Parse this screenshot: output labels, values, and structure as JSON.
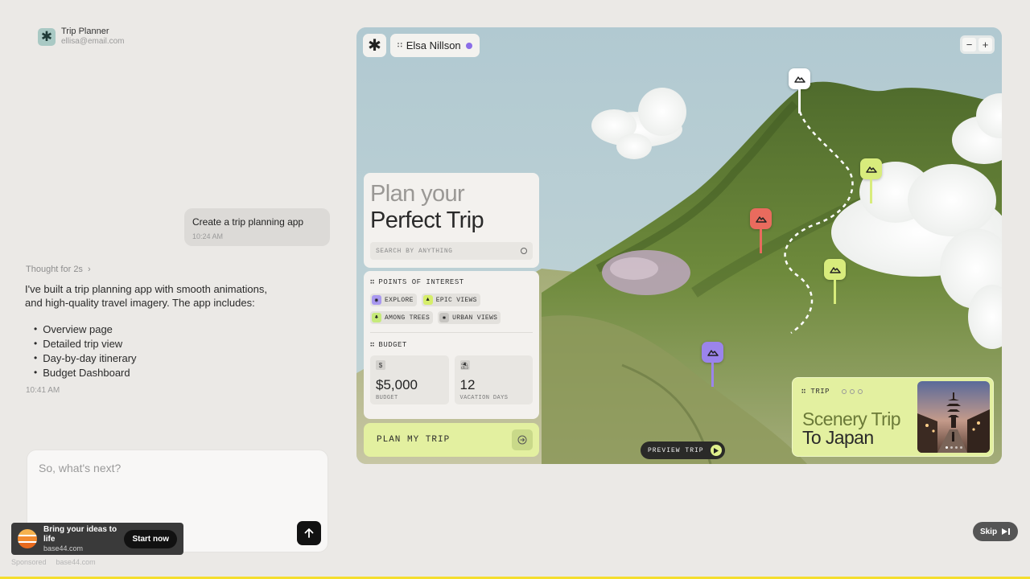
{
  "app": {
    "title": "Trip Planner",
    "email": "ellisa@email.com"
  },
  "chat": {
    "user_message": {
      "text": "Create a trip planning app",
      "time": "10:24 AM"
    },
    "thought": "Thought for 2s",
    "assistant_intro": "I've built a trip planning app with smooth animations, and high-quality travel imagery. The app includes:",
    "features": [
      "Overview page",
      "Detailed trip view",
      "Day-by-day itinerary",
      "Budget Dashboard"
    ],
    "assistant_time": "10:41 AM"
  },
  "composer": {
    "placeholder": "So, what's next?"
  },
  "ad": {
    "title": "Bring your ideas to life",
    "domain": "base44.com",
    "button": "Start now",
    "sponsored": "Sponsored",
    "sponsored_domain": "base44.com"
  },
  "skip": {
    "label": "Skip"
  },
  "preview": {
    "user_name": "Elsa Nillson",
    "zoom": {
      "minus": "−",
      "plus": "+"
    },
    "plan": {
      "title_line1": "Plan your",
      "title_line2": "Perfect Trip",
      "search_placeholder": "SEARCH BY ANYTHING"
    },
    "poi": {
      "heading": "POINTS OF INTEREST",
      "tags": [
        {
          "label": "EXPLORE",
          "color": "#a998f0"
        },
        {
          "label": "EPIC VIEWS",
          "color": "#d6ee6a"
        },
        {
          "label": "AMONG TREES",
          "color": "#c6ea7a"
        },
        {
          "label": "URBAN VIEWS",
          "color": "#c7c5c1"
        }
      ]
    },
    "budget": {
      "heading": "BUDGET",
      "amount": "$5,000",
      "amount_label": "BUDGET",
      "amount_icon": "$",
      "days": "12",
      "days_label": "VACATION DAYS"
    },
    "plan_button": "PLAN MY TRIP",
    "preview_trip": "PREVIEW TRIP",
    "trip_card": {
      "label": "TRIP",
      "title_line1": "Scenery Trip",
      "title_line2": "To Japan"
    },
    "pins": [
      {
        "name": "pin-summit",
        "color": "#ffffff"
      },
      {
        "name": "pin-green-right",
        "color": "#d8ec7c"
      },
      {
        "name": "pin-red",
        "color": "#e96b5e"
      },
      {
        "name": "pin-green-middle",
        "color": "#d8ec7c"
      },
      {
        "name": "pin-purple",
        "color": "#9b84ec"
      }
    ]
  }
}
